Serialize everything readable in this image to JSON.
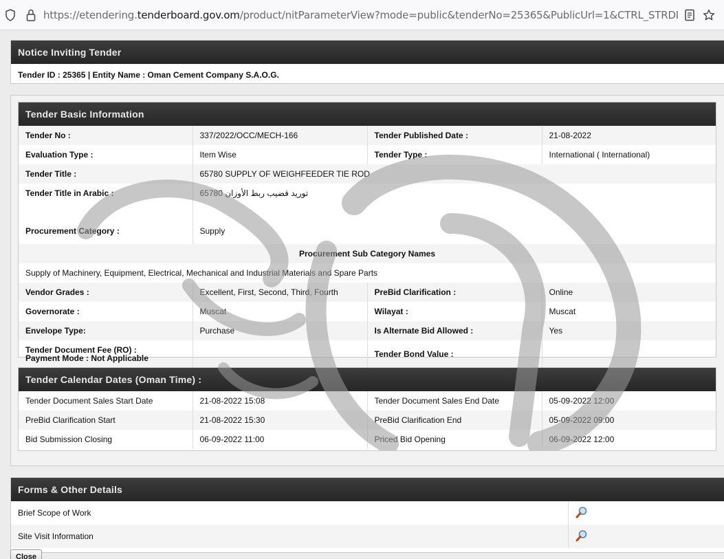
{
  "browser": {
    "url_prefix": "https://etendering.",
    "url_domain": "tenderboard.gov.om",
    "url_rest": "/product/nitParameterView?mode=public&tenderNo=25365&PublicUrl=1&CTRL_STRDIRECTION=LTR&encparar"
  },
  "notice": {
    "title": "Notice Inviting Tender",
    "subtitle": "Tender ID : 25365 | Entity Name : Oman Cement Company S.A.O.G."
  },
  "basic": {
    "title": "Tender Basic Information",
    "tender_no_label": "Tender No :",
    "tender_no": "337/2022/OCC/MECH-166",
    "published_label": "Tender Published Date :",
    "published": "21-08-2022",
    "eval_label": "Evaluation Type :",
    "eval": "Item Wise",
    "type_label": "Tender Type :",
    "type": "International  ( International)",
    "title_label": "Tender Title :",
    "tender_title": "65780 SUPPLY OF WEIGHFEEDER TIE ROD",
    "arabic_label": "Tender Title in Arabic :",
    "arabic": "65780 توريد قضيب ربط الأوزان",
    "proc_label": "Procurement Category :",
    "proc": "Supply",
    "sub_header": "Procurement Sub Category Names",
    "sub_value": "Supply of Machinery, Equipment, Electrical, Mechanical and Industrial Materials and Spare Parts",
    "grades_label": "Vendor Grades :",
    "grades": "Excellent, First, Second, Third, Fourth",
    "prebid_label": "PreBid Clarification :",
    "prebid": "Online",
    "gov_label": "Governorate :",
    "gov": "Muscat",
    "wilayat_label": "Wilayat :",
    "wilayat": "Muscat",
    "env_label": "Envelope Type:",
    "env": "Purchase",
    "alt_label": "Is Alternate Bid Allowed :",
    "alt": "Yes",
    "fee_label": "Tender Document Fee (RO) :",
    "paymode_label": "Payment Mode :  Not Applicable",
    "bond_label": "Tender Bond Value :"
  },
  "calendar": {
    "title": "Tender Calendar Dates (Oman Time) :",
    "rows": [
      {
        "l1": "Tender Document Sales Start Date",
        "v1": "21-08-2022 15:08",
        "l2": "Tender Document Sales End Date",
        "v2": "05-09-2022 12:00"
      },
      {
        "l1": "PreBid Clarification Start",
        "v1": "21-08-2022 15:30",
        "l2": "PreBid Clarification End",
        "v2": "05-09-2022 09:00"
      },
      {
        "l1": "Bid Submission Closing",
        "v1": "06-09-2022 11:00",
        "l2": "Priced Bid Opening",
        "v2": "06-09-2022 12:00"
      }
    ]
  },
  "forms": {
    "title": "Forms & Other Details",
    "rows": [
      {
        "label": "Brief Scope of Work",
        "icon": "magnifier-icon"
      },
      {
        "label": "Site Visit Information",
        "icon": "magnifier-icon"
      }
    ]
  },
  "close_label": "Close"
}
